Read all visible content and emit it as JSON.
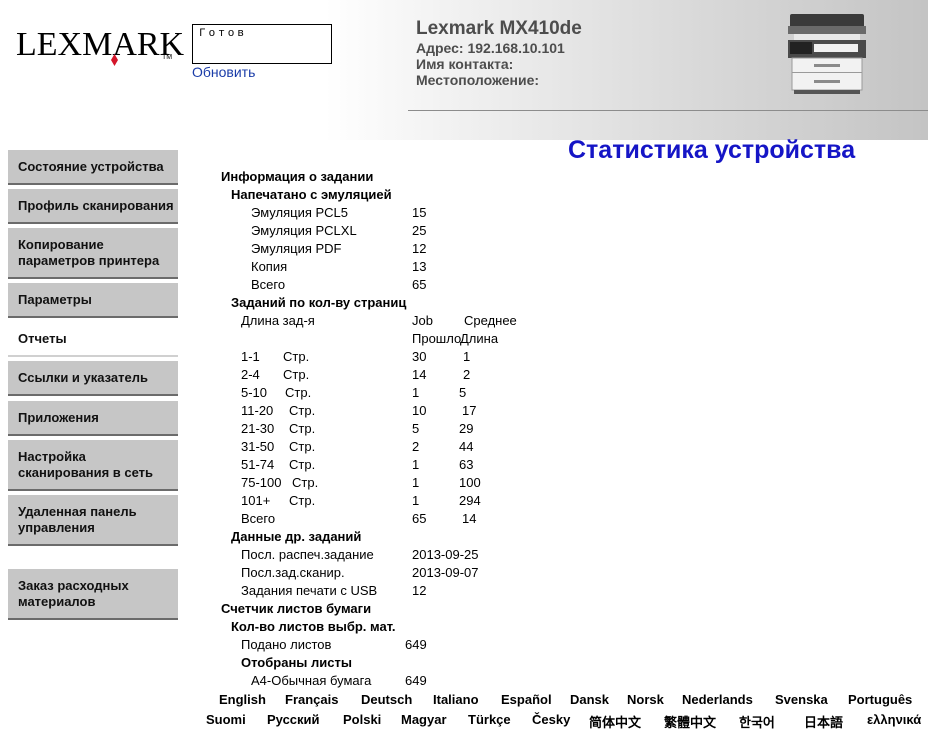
{
  "header": {
    "logo_text": "LEXMARK",
    "logo_tm": "TM",
    "status": "Готов",
    "refresh_link": "Обновить",
    "model": "Lexmark MX410de",
    "address": "Адрес: 192.168.10.101",
    "contact": "Имя контакта:",
    "location": "Местоположение:"
  },
  "nav": [
    {
      "label": "Состояние устройства"
    },
    {
      "label": "Профиль сканирования"
    },
    {
      "label": "Копирование параметров принтера"
    },
    {
      "label": "Параметры"
    },
    {
      "label": "Отчеты",
      "active": true
    },
    {
      "label": "Ссылки и указатель"
    },
    {
      "label": "Приложения"
    },
    {
      "label": "Настройка сканирования в сеть"
    },
    {
      "label": "Удаленная панель управления"
    },
    {
      "label": "Заказ расходных материалов"
    }
  ],
  "page_title": "Статистика устройства",
  "stats": {
    "job_info": "Информация о задании",
    "printed_emulation": "Напечатано с эмуляцией",
    "emulation_rows": [
      {
        "label": "Эмуляция PCL5",
        "value": "15"
      },
      {
        "label": "Эмуляция PCLXL",
        "value": "25"
      },
      {
        "label": "Эмуляция PDF",
        "value": "12"
      },
      {
        "label": "Копия",
        "value": "13"
      },
      {
        "label": "Всего",
        "value": "65"
      }
    ],
    "jobs_by_pages": "Заданий по кол-ву страниц",
    "col_length": "Длина зад-я",
    "col_job": "Job",
    "col_avg": "Среднее",
    "col_job2": "Прошло",
    "col_avg2": "Длина",
    "page_rows": [
      {
        "range": "1-1",
        "unit": "Стр.",
        "jobs": "30",
        "avg": "1"
      },
      {
        "range": "2-4",
        "unit": "Стр.",
        "jobs": "14",
        "avg": "2"
      },
      {
        "range": "5-10",
        "unit": "Стр.",
        "jobs": "1",
        "avg": "5"
      },
      {
        "range": "11-20",
        "unit": "Стр.",
        "jobs": "10",
        "avg": "17"
      },
      {
        "range": "21-30",
        "unit": "Стр.",
        "jobs": "5",
        "avg": "29"
      },
      {
        "range": "31-50",
        "unit": "Стр.",
        "jobs": "2",
        "avg": "44"
      },
      {
        "range": "51-74",
        "unit": "Стр.",
        "jobs": "1",
        "avg": "63"
      },
      {
        "range": "75-100",
        "unit": "Стр.",
        "jobs": "1",
        "avg": "100"
      },
      {
        "range": "101+",
        "unit": "Стр.",
        "jobs": "1",
        "avg": "294"
      }
    ],
    "pages_total_label": "Всего",
    "pages_total_jobs": "65",
    "pages_total_avg": "14",
    "other_jobs": "Данные др. заданий",
    "other_rows": [
      {
        "label": "Посл. распеч.задание",
        "value": "2013-09-25"
      },
      {
        "label": "Посл.зад.сканир.",
        "value": "2013-09-07"
      },
      {
        "label": "Задания печати с USB",
        "value": "12"
      }
    ],
    "paper_counter": "Счетчик листов бумаги",
    "sheets_media": "Кол-во листов выбр. мат.",
    "fed_sheets_label": "Подано листов",
    "fed_sheets_value": "649",
    "picked_sheets": "Отобраны листы",
    "a4_label": "А4-Обычная бумага",
    "a4_value": "649"
  },
  "languages_row1": [
    "English",
    "Français",
    "Deutsch",
    "Italiano",
    "Español",
    "Dansk",
    "Norsk",
    "Nederlands",
    "Svenska",
    "Português"
  ],
  "languages_row2": [
    "Suomi",
    "Русский",
    "Polski",
    "Magyar",
    "Türkçe",
    "Česky",
    "简体中文",
    "繁體中文",
    "한국어",
    "日本語",
    "ελληνικά"
  ],
  "colors": {
    "title_blue": "#1515c6",
    "link_blue": "#1a3ca8",
    "logo_red": "#d4152a",
    "nav_gray": "#c6c6c6"
  }
}
